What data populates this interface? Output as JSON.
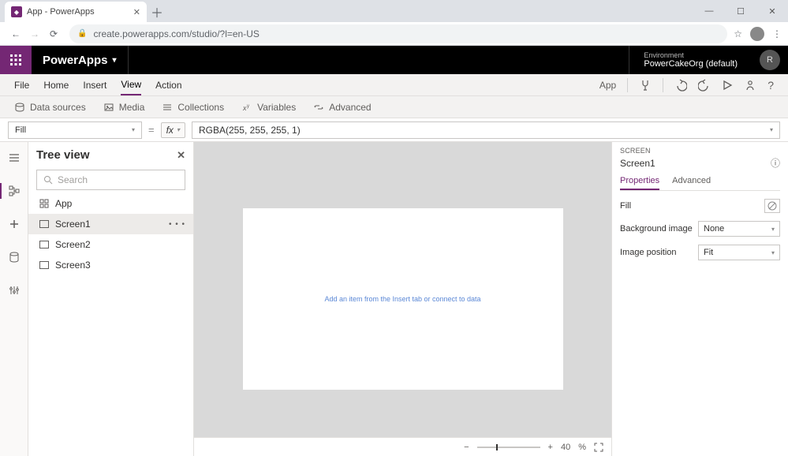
{
  "browser": {
    "tab_title": "App - PowerApps",
    "url": "create.powerapps.com/studio/?l=en-US"
  },
  "header": {
    "brand": "PowerApps",
    "env_label": "Environment",
    "env_name": "PowerCakeOrg (default)"
  },
  "menu": {
    "items": [
      "File",
      "Home",
      "Insert",
      "View",
      "Action"
    ],
    "active": "View",
    "app_label": "App"
  },
  "ribbon": {
    "data_sources": "Data sources",
    "media": "Media",
    "collections": "Collections",
    "variables": "Variables",
    "advanced": "Advanced"
  },
  "formula": {
    "property": "Fill",
    "value": "RGBA(255, 255, 255, 1)"
  },
  "tree": {
    "title": "Tree view",
    "search_placeholder": "Search",
    "app_item": "App",
    "screens": [
      "Screen1",
      "Screen2",
      "Screen3"
    ],
    "selected": "Screen1"
  },
  "canvas": {
    "hint": "Add an item from the Insert tab or connect to data",
    "zoom_value": "40",
    "zoom_unit": "%"
  },
  "props": {
    "section_label": "SCREEN",
    "screen_name": "Screen1",
    "tab_properties": "Properties",
    "tab_advanced": "Advanced",
    "fill_label": "Fill",
    "bg_image_label": "Background image",
    "bg_image_value": "None",
    "img_pos_label": "Image position",
    "img_pos_value": "Fit"
  }
}
